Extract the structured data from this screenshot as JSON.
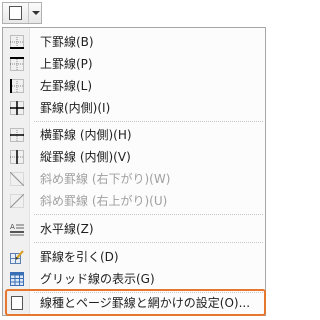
{
  "toolbar": {
    "button_icon": "page-border-icon",
    "dropdown_icon": "chevron-down-icon"
  },
  "menu": {
    "items": [
      {
        "label": "下罫線(B)",
        "icon": "border-bottom-icon",
        "disabled": false
      },
      {
        "label": "上罫線(P)",
        "icon": "border-top-icon",
        "disabled": false
      },
      {
        "label": "左罫線(L)",
        "icon": "border-left-icon",
        "disabled": false
      },
      {
        "label": "罫線(内側)(I)",
        "icon": "border-inside-icon",
        "disabled": false
      },
      {
        "label": "横罫線 (内側)(H)",
        "icon": "border-inside-horizontal-icon",
        "disabled": false
      },
      {
        "label": "縦罫線 (内側)(V)",
        "icon": "border-inside-vertical-icon",
        "disabled": false
      },
      {
        "label": "斜め罫線 (右下がり)(W)",
        "icon": "diagonal-down-border-icon",
        "disabled": true
      },
      {
        "label": "斜め罫線 (右上がり)(U)",
        "icon": "diagonal-up-border-icon",
        "disabled": true
      },
      {
        "label": "水平線(Z)",
        "icon": "horizontal-line-icon",
        "disabled": false
      },
      {
        "label": "罫線を引く(D)",
        "icon": "draw-table-icon",
        "disabled": false
      },
      {
        "label": "グリッド線の表示(G)",
        "icon": "view-gridlines-icon",
        "disabled": false
      },
      {
        "label": "線種とページ罫線と網かけの設定(O)...",
        "icon": "borders-and-shading-icon",
        "disabled": false
      }
    ]
  },
  "colors": {
    "highlight": "#e5772f",
    "icon_blue": "#3a6fb5"
  }
}
